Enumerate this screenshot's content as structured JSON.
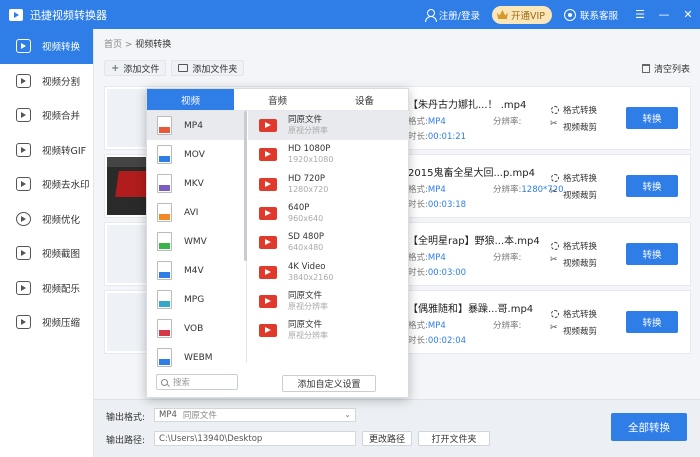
{
  "app": {
    "title": "迅捷视频转换器",
    "login": "注册/登录",
    "vip": "开通VIP",
    "service": "联系客服"
  },
  "sidebar": {
    "items": [
      {
        "label": "视频转换",
        "active": true
      },
      {
        "label": "视频分割"
      },
      {
        "label": "视频合并"
      },
      {
        "label": "视频转GIF"
      },
      {
        "label": "视频去水印"
      },
      {
        "label": "视频优化"
      },
      {
        "label": "视频截图"
      },
      {
        "label": "视频配乐"
      },
      {
        "label": "视频压缩"
      }
    ]
  },
  "breadcrumb": {
    "home": "首页",
    "sep": " > ",
    "current": "视频转换"
  },
  "toolbar": {
    "add_file": "添加文件",
    "add_folder": "添加文件夹",
    "clear": "清空列表"
  },
  "files": [
    {
      "name": "【朱丹古力娜扎...！ .mp4",
      "format_label": "格式:",
      "format": "MP4",
      "res_label": "分辨率:",
      "res": "",
      "dur_label": "时长:",
      "duration": "00:01:21",
      "act1": "格式转换",
      "act2": "视频裁剪",
      "button": "转换"
    },
    {
      "name": "2015鬼畜全星大回...p.mp4",
      "format_label": "格式:",
      "format": "MP4",
      "res_label": "分辨率:",
      "res": "1280*720",
      "dur_label": "时长:",
      "duration": "00:03:18",
      "act1": "格式转换",
      "act2": "视频裁剪",
      "button": "转换"
    },
    {
      "name": "【全明星rap】野狼...本.mp4",
      "format_label": "格式:",
      "format": "MP4",
      "res_label": "分辨率:",
      "res": "",
      "dur_label": "时长:",
      "duration": "00:03:00",
      "act1": "格式转换",
      "act2": "视频裁剪",
      "button": "转换"
    },
    {
      "name": "【偶雅随和】暴躁...哥.mp4",
      "format_label": "格式:",
      "format": "MP4",
      "res_label": "分辨率:",
      "res": "",
      "dur_label": "时长:",
      "duration": "00:02:04",
      "act1": "格式转换",
      "act2": "视频裁剪",
      "button": "转换"
    }
  ],
  "popup": {
    "tabs": [
      "视频",
      "音频",
      "设备"
    ],
    "formats": [
      {
        "label": "MP4",
        "color": "#e8593a",
        "active": true
      },
      {
        "label": "MOV",
        "color": "#2f7ee8"
      },
      {
        "label": "MKV",
        "color": "#7a5cc2"
      },
      {
        "label": "AVI",
        "color": "#f08a24"
      },
      {
        "label": "WMV",
        "color": "#3ab54a"
      },
      {
        "label": "M4V",
        "color": "#2f7ee8"
      },
      {
        "label": "MPG",
        "color": "#35a8c8"
      },
      {
        "label": "VOB",
        "color": "#d6384a"
      },
      {
        "label": "WEBM",
        "color": "#2f7ee8"
      }
    ],
    "search_placeholder": "搜索",
    "qualities": [
      {
        "name": "同原文件",
        "desc": "原视分辨率",
        "active": true
      },
      {
        "name": "HD 1080P",
        "desc": "1920x1080"
      },
      {
        "name": "HD 720P",
        "desc": "1280x720"
      },
      {
        "name": "640P",
        "desc": "960x640"
      },
      {
        "name": "SD 480P",
        "desc": "640x480"
      },
      {
        "name": "4K Video",
        "desc": "3840x2160"
      },
      {
        "name": "同原文件",
        "desc": "原视分辨率"
      },
      {
        "name": "同原文件",
        "desc": "原视分辨率"
      }
    ],
    "custom_button": "添加自定义设置"
  },
  "bottom": {
    "format_label": "输出格式:",
    "format_value": "MP4",
    "format_hint": "同原文件",
    "path_label": "输出路径:",
    "path_value": "C:\\Users\\13940\\Desktop",
    "change_path": "更改路径",
    "open_folder": "打开文件夹",
    "convert_all": "全部转换"
  }
}
